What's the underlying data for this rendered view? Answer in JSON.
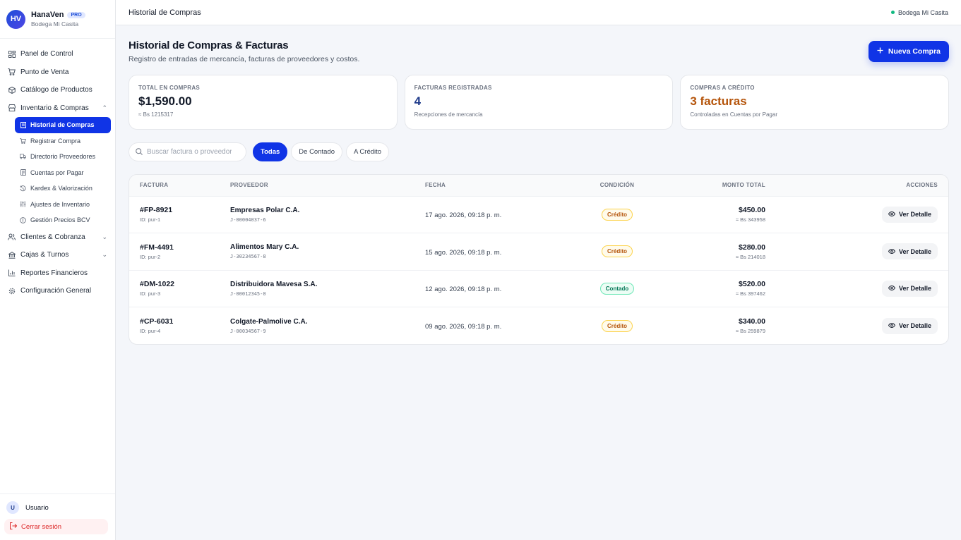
{
  "brand": {
    "initials": "HV",
    "name": "HanaVen",
    "badge": "PRO",
    "store": "Bodega Mi Casita"
  },
  "sidebar": {
    "items": [
      {
        "label": "Panel de Control",
        "icon": "dashboard-icon"
      },
      {
        "label": "Punto de Venta",
        "icon": "cart-icon"
      },
      {
        "label": "Catálogo de Productos",
        "icon": "box-icon"
      },
      {
        "label": "Inventario & Compras",
        "icon": "store-icon"
      },
      {
        "label": "Clientes & Cobranza",
        "icon": "users-icon"
      },
      {
        "label": "Cajas & Turnos",
        "icon": "bank-icon"
      },
      {
        "label": "Reportes Financieros",
        "icon": "chart-icon"
      },
      {
        "label": "Configuración General",
        "icon": "gear-icon"
      }
    ],
    "subitems": [
      {
        "label": "Historial de Compras",
        "active": true
      },
      {
        "label": "Registrar Compra"
      },
      {
        "label": "Directorio Proveedores"
      },
      {
        "label": "Cuentas por Pagar"
      },
      {
        "label": "Kardex & Valorización"
      },
      {
        "label": "Ajustes de Inventario"
      },
      {
        "label": "Gestión Precios BCV"
      }
    ],
    "user": {
      "initial": "U",
      "name": "Usuario"
    },
    "logout": "Cerrar sesión"
  },
  "topbar": {
    "title": "Historial de Compras",
    "store": "Bodega Mi Casita",
    "status_color": "#10b981"
  },
  "page": {
    "title": "Historial de Compras & Facturas",
    "subtitle": "Registro de entradas de mercancía, facturas de proveedores y costos.",
    "new_button": "Nueva Compra"
  },
  "cards": [
    {
      "label": "TOTAL EN COMPRAS",
      "value": "$1,590.00",
      "note": "≈ Bs 1215317"
    },
    {
      "label": "FACTURAS REGISTRADAS",
      "value": "4",
      "note": "Recepciones de mercancía"
    },
    {
      "label": "COMPRAS A CRÉDITO",
      "value": "3 facturas",
      "note": "Controladas en Cuentas por Pagar"
    }
  ],
  "filters": {
    "search_placeholder": "Buscar factura o proveedor",
    "tabs": [
      "Todas",
      "De Contado",
      "A Crédito"
    ],
    "active_tab": "Todas"
  },
  "table": {
    "columns": [
      "FACTURA",
      "PROVEEDOR",
      "FECHA",
      "CONDICIÓN",
      "MONTO TOTAL",
      "ACCIONES"
    ],
    "action_label": "Ver Detalle",
    "rows": [
      {
        "invoice": "#FP-8921",
        "id": "ID: pur-1",
        "supplier": "Empresas Polar C.A.",
        "rif": "J-00004037-6",
        "date": "17 ago. 2026, 09:18 p. m.",
        "condition": "Crédito",
        "amount": "$450.00",
        "amount_bs": "≈ Bs 343958"
      },
      {
        "invoice": "#FM-4491",
        "id": "ID: pur-2",
        "supplier": "Alimentos Mary C.A.",
        "rif": "J-30234567-8",
        "date": "15 ago. 2026, 09:18 p. m.",
        "condition": "Crédito",
        "amount": "$280.00",
        "amount_bs": "≈ Bs 214018"
      },
      {
        "invoice": "#DM-1022",
        "id": "ID: pur-3",
        "supplier": "Distribuidora Mavesa S.A.",
        "rif": "J-00012345-0",
        "date": "12 ago. 2026, 09:18 p. m.",
        "condition": "Contado",
        "amount": "$520.00",
        "amount_bs": "≈ Bs 397462"
      },
      {
        "invoice": "#CP-6031",
        "id": "ID: pur-4",
        "supplier": "Colgate-Palmolive C.A.",
        "rif": "J-00034567-9",
        "date": "09 ago. 2026, 09:18 p. m.",
        "condition": "Crédito",
        "amount": "$340.00",
        "amount_bs": "≈ Bs 259879"
      }
    ]
  },
  "colors": {
    "accent": "#1034e6",
    "credit": "#b45309",
    "cash": "#047857",
    "logout": "#dc2626"
  }
}
